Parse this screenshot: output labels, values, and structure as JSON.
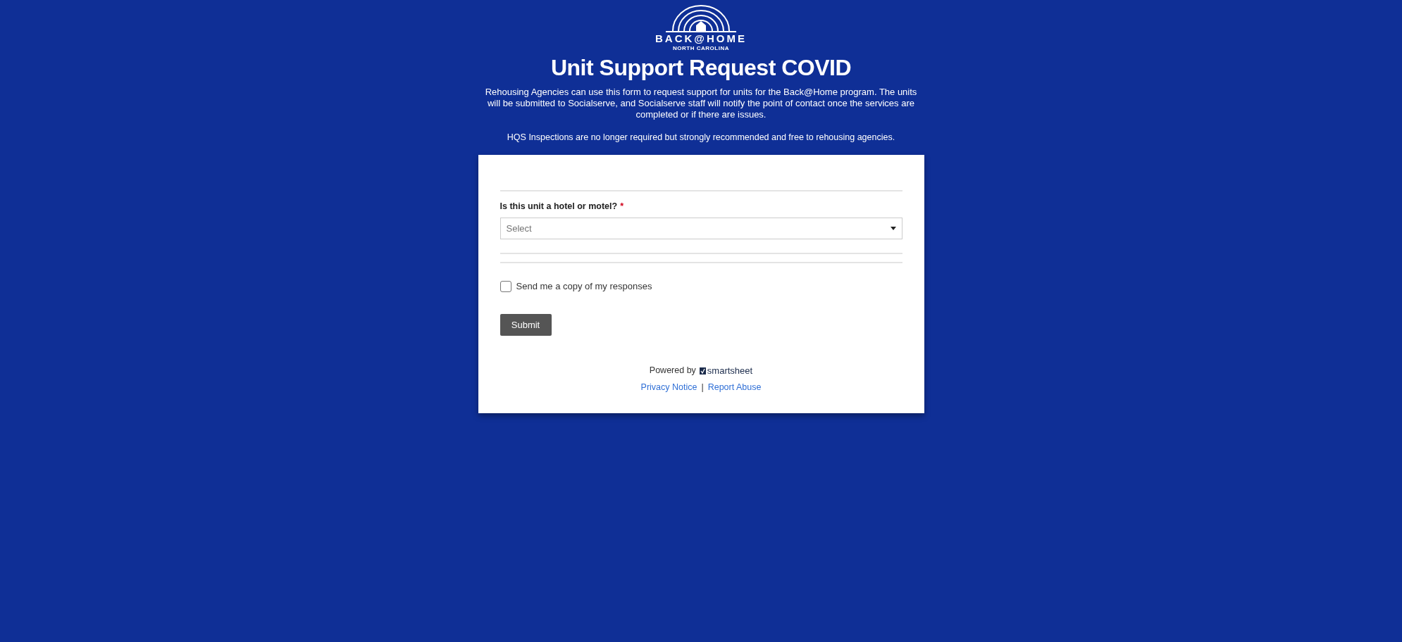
{
  "logo": {
    "wordmark": "BACK@HOME",
    "subtitle": "NORTH CAROLINA"
  },
  "title": "Unit Support Request COVID",
  "description": "Rehousing Agencies can use this form to request support for units for the Back@Home program. The units will be submitted to Socialserve, and Socialserve staff will notify the point of contact once the services are completed or if there are issues.",
  "note": "HQS Inspections are no longer required but strongly recommended and free to rehousing agencies.",
  "form": {
    "question": {
      "label": "Is this unit a hotel or motel?",
      "required_mark": "*",
      "placeholder": "Select"
    },
    "copy_checkbox": {
      "label": "Send me a copy of my responses",
      "checked": false
    },
    "submit": "Submit"
  },
  "footer": {
    "powered_by": "Powered by",
    "brand": "smartsheet",
    "links": [
      "Privacy Notice",
      "Report Abuse"
    ],
    "separator": "|"
  }
}
